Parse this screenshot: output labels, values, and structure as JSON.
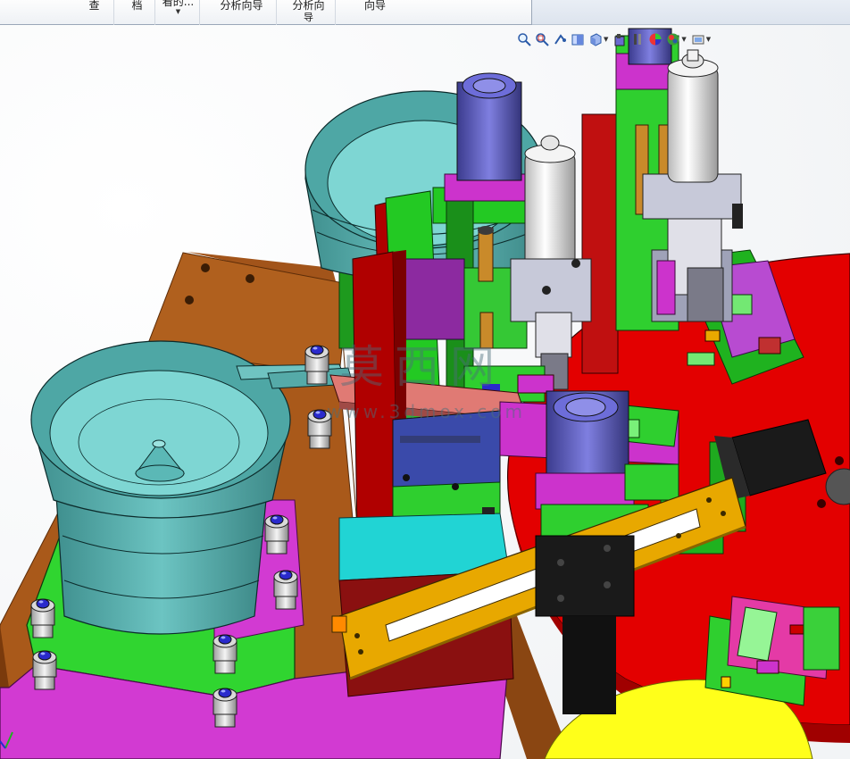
{
  "ribbon": {
    "buttons": [
      {
        "id": "cmd-1",
        "line1": "查",
        "line2": ""
      },
      {
        "id": "cmd-2",
        "line1": "档",
        "line2": ""
      },
      {
        "id": "cmd-3",
        "line1": "看的...",
        "line2": ""
      },
      {
        "id": "cmd-4",
        "line1": "分析向导",
        "line2": ""
      },
      {
        "id": "cmd-5",
        "line1": "分析向",
        "line2": "导"
      },
      {
        "id": "cmd-6",
        "line1": "向导",
        "line2": ""
      }
    ]
  },
  "hud_toolbar": {
    "icons": [
      "zoom-to-fit-icon",
      "zoom-to-area-icon",
      "previous-view-icon",
      "section-view-icon",
      "view-orientation-icon",
      "display-style-icon",
      "hide-show-items-icon",
      "edit-appearance-icon",
      "apply-scene-icon",
      "view-settings-icon"
    ]
  },
  "watermark": {
    "title": "莫西网",
    "url": "www.3dmox.com"
  },
  "colors": {
    "table_wood": "#a85a17",
    "bowl_teal": "#5fb5b3",
    "turntable_red": "#e30000",
    "plate_green": "#2fcf2f",
    "plate_magenta": "#cc33cc",
    "arm_yellow": "#e8a800",
    "cylinder_purple": "#6a6ad0"
  }
}
